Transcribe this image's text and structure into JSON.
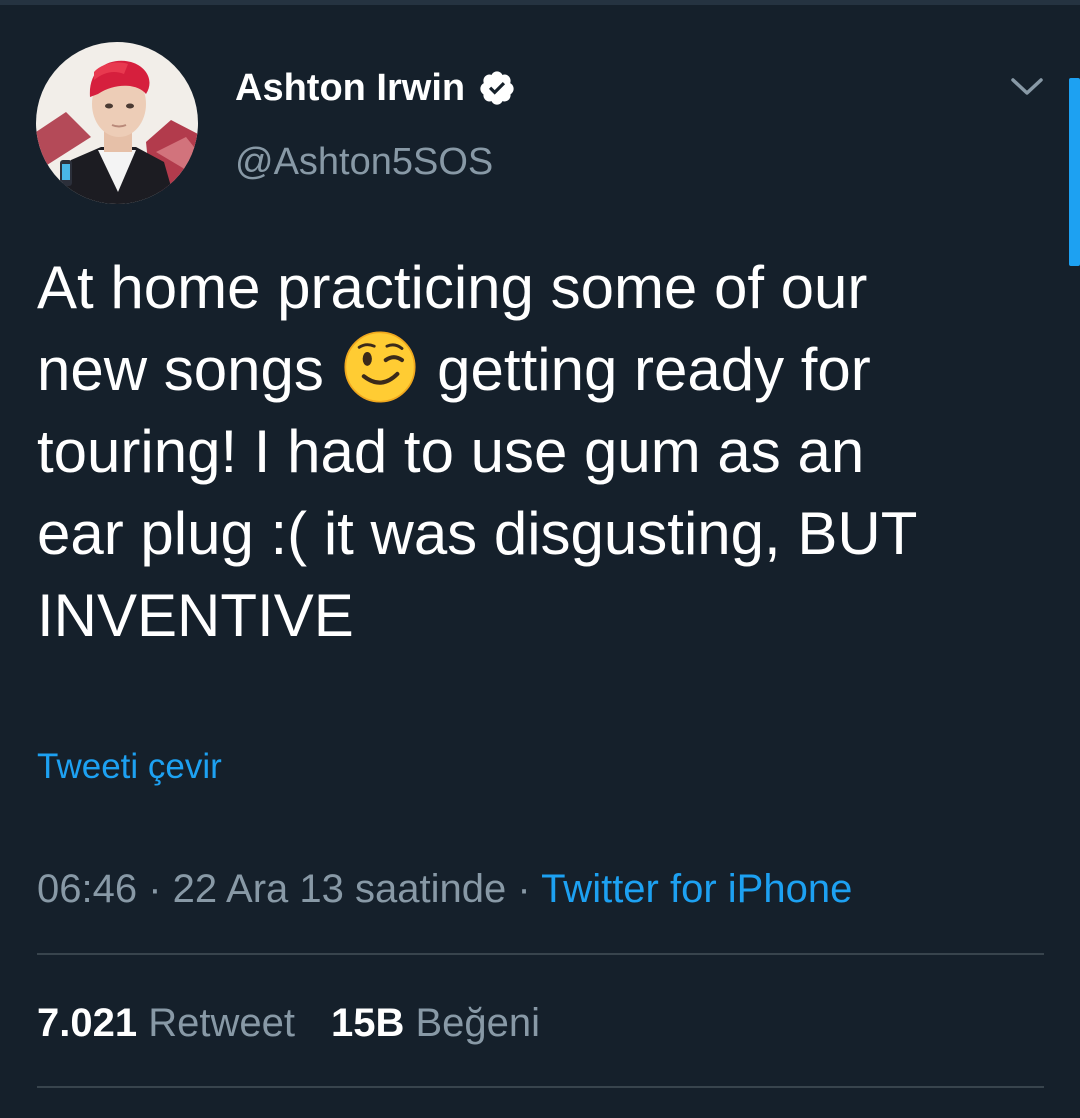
{
  "tweet": {
    "author": {
      "display_name": "Ashton Irwin",
      "handle": "@Ashton5SOS",
      "verified": true
    },
    "text_line1": "At home practicing some of our",
    "text_line2a": "new songs ",
    "text_emoji": "😉",
    "text_line2b": " getting ready for",
    "text_line3": "touring! I had to use gum as an",
    "text_line4": "ear plug :( it was disgusting, BUT",
    "text_line5": "INVENTIVE",
    "translate_label": "Tweeti çevir",
    "time": "06:46",
    "separator": " · ",
    "date": "22 Ara 13 saatinde",
    "source": "Twitter for iPhone",
    "stats": {
      "retweets_value": "7.021",
      "retweets_label": "Retweet",
      "likes_value": "15B",
      "likes_label": "Beğeni"
    }
  },
  "icons": {
    "verified": "verified-badge-icon",
    "menu": "chevron-down-icon",
    "emoji": "winking-face-emoji"
  },
  "colors": {
    "background": "#15202b",
    "accent": "#1da1f2",
    "secondary_text": "#8899a6",
    "divider": "#38444d"
  }
}
